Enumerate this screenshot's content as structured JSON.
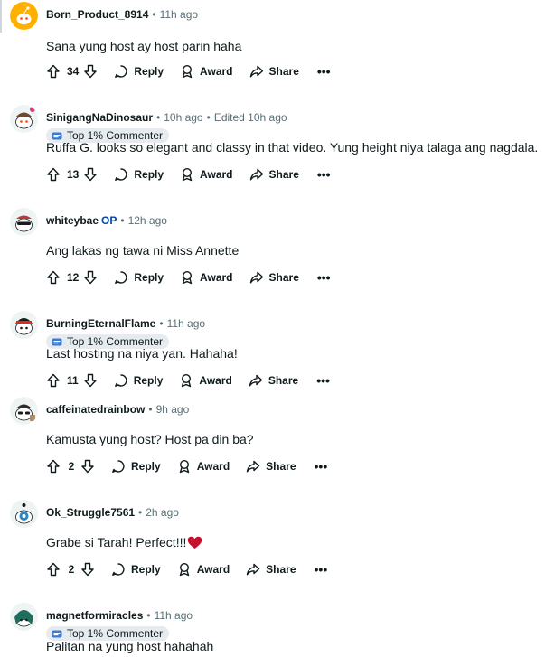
{
  "colors": {
    "op_label": "#0045ac",
    "badge_bg": "#e5ebee",
    "meta_text": "#576f76",
    "heart": "#c8102e"
  },
  "labels": {
    "reply": "Reply",
    "award": "Award",
    "share": "Share",
    "more": "•••",
    "separator": "•"
  },
  "comments": [
    {
      "username": "Born_Product_8914",
      "time": "11h ago",
      "body": "Sana yung host ay host parin haha",
      "votes": "34",
      "avatar_icon": "snoo-avatar-icon"
    },
    {
      "username": "SinigangNaDinosaur",
      "time": "10h ago",
      "edited": "Edited 10h ago",
      "badge": "Top 1% Commenter",
      "body": "Ruffa G. looks so elegant and classy in that video. Yung height niya talaga ang nagdala.",
      "votes": "13",
      "avatar_icon": "snoo-avatar-icon"
    },
    {
      "username": "whiteybae",
      "op": "OP",
      "time": "12h ago",
      "body": "Ang lakas ng tawa ni Miss Annette",
      "votes": "12",
      "avatar_icon": "snoo-avatar-icon"
    },
    {
      "username": "BurningEternalFlame",
      "time": "11h ago",
      "badge": "Top 1% Commenter",
      "body": "Last hosting na niya yan. Hahaha!",
      "votes": "11",
      "avatar_icon": "snoo-avatar-icon"
    },
    {
      "username": "caffeinatedrainbow",
      "time": "9h ago",
      "body": "Kamusta yung host? Host pa din ba?",
      "votes": "2",
      "avatar_icon": "snoo-avatar-icon"
    },
    {
      "username": "Ok_Struggle7561",
      "time": "2h ago",
      "body": "Grabe si Tarah! Perfect!!!",
      "votes": "2",
      "avatar_icon": "snoo-avatar-icon"
    },
    {
      "username": "magnetformiracles",
      "time": "11h ago",
      "badge": "Top 1% Commenter",
      "body": "Palitan na yung host hahahah",
      "avatar_icon": "snoo-avatar-icon"
    }
  ]
}
